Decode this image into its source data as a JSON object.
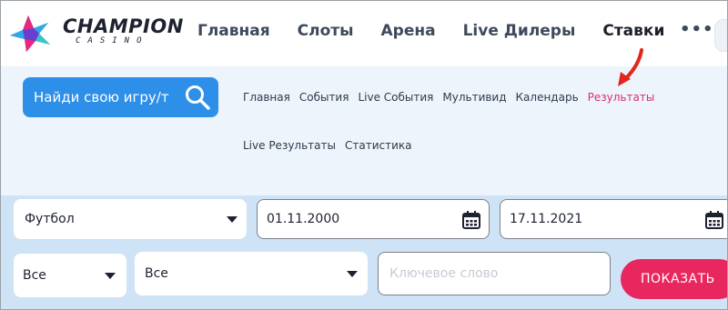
{
  "brand": {
    "name": "CHAMPION",
    "subtitle": "CASINO",
    "colors": {
      "star_pink": "#e6297f",
      "star_blue": "#2ea8e6",
      "star_purple": "#6a3fd0"
    }
  },
  "header": {
    "nav": [
      {
        "label": "Главная"
      },
      {
        "label": "Слоты"
      },
      {
        "label": "Арена"
      },
      {
        "label": "Live Дилеры"
      },
      {
        "label": "Ставки",
        "active": true
      }
    ],
    "more_label": "•••"
  },
  "search": {
    "label": "Найди свою игру/т",
    "icon": "search-icon",
    "color": "#2e8fe8"
  },
  "subnav": {
    "items": [
      {
        "label": "Главная"
      },
      {
        "label": "События"
      },
      {
        "label": "Live События"
      },
      {
        "label": "Мультивид"
      },
      {
        "label": "Календарь"
      },
      {
        "label": "Результаты",
        "highlight": true
      }
    ],
    "items_row2": [
      {
        "label": "Live Результаты"
      },
      {
        "label": "Статистика"
      }
    ],
    "highlight_color": "#d6316f"
  },
  "annotation": {
    "icon": "red-arrow-icon",
    "color": "#e3261b"
  },
  "filters": {
    "sport": {
      "value": "Футбол"
    },
    "date_from": {
      "value": "01.11.2000"
    },
    "date_to": {
      "value": "17.11.2021"
    },
    "filter_a": {
      "value": "Все"
    },
    "filter_b": {
      "value": "Все"
    },
    "keyword": {
      "placeholder": "Ключевое слово"
    },
    "submit": {
      "label": "ПОКАЗАТЬ",
      "color": "#e9275f"
    }
  }
}
